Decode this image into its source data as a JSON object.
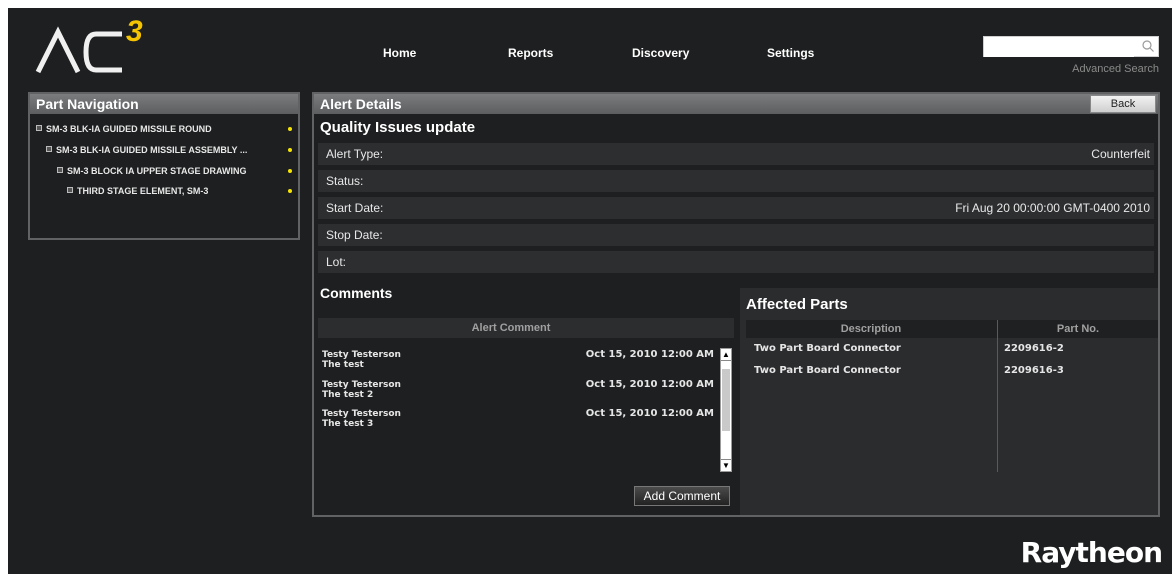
{
  "logo": {
    "text": "AC",
    "superscript": "3"
  },
  "nav": {
    "items": [
      {
        "label": "Home"
      },
      {
        "label": "Reports"
      },
      {
        "label": "Discovery"
      },
      {
        "label": "Settings"
      }
    ]
  },
  "search": {
    "value": "",
    "placeholder": "",
    "advanced_label": "Advanced Search"
  },
  "part_navigation": {
    "title": "Part Navigation",
    "items": [
      {
        "label": "SM-3 BLK-IA GUIDED MISSILE ROUND",
        "level": 0
      },
      {
        "label": "SM-3 BLK-IA GUIDED MISSILE ASSEMBLY ...",
        "level": 1
      },
      {
        "label": "SM-3 BLOCK IA UPPER STAGE DRAWING",
        "level": 2
      },
      {
        "label": "THIRD STAGE ELEMENT, SM-3",
        "level": 3
      }
    ]
  },
  "alert_details": {
    "title": "Alert Details",
    "back_label": "Back",
    "subtitle": "Quality Issues update",
    "fields": [
      {
        "label": "Alert Type:",
        "value": "Counterfeit"
      },
      {
        "label": "Status:",
        "value": ""
      },
      {
        "label": "Start Date:",
        "value": "Fri Aug 20 00:00:00 GMT-0400 2010"
      },
      {
        "label": "Stop Date:",
        "value": ""
      },
      {
        "label": "Lot:",
        "value": ""
      }
    ]
  },
  "comments": {
    "title": "Comments",
    "column_header": "Alert Comment",
    "items": [
      {
        "author": "Testy Testerson",
        "text": "The test",
        "date": "Oct 15, 2010 12:00 AM"
      },
      {
        "author": "Testy Testerson",
        "text": "The test 2",
        "date": "Oct 15, 2010 12:00 AM"
      },
      {
        "author": "Testy Testerson",
        "text": "The test 3",
        "date": "Oct 15, 2010 12:00 AM"
      }
    ],
    "add_label": "Add Comment"
  },
  "affected_parts": {
    "title": "Affected Parts",
    "headers": [
      "Description",
      "Part No."
    ],
    "rows": [
      {
        "description": "Two Part Board Connector",
        "part_no": "2209616-2"
      },
      {
        "description": "Two Part Board Connector",
        "part_no": "2209616-3"
      }
    ]
  },
  "footer": {
    "brand": "Raytheon"
  }
}
